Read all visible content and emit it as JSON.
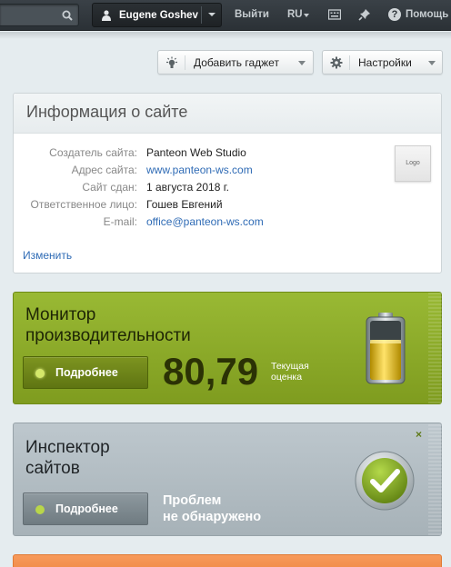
{
  "topbar": {
    "user_name": "Eugene Goshev",
    "logout_label": "Выйти",
    "language": "RU",
    "help_label": "Помощь"
  },
  "toolbar": {
    "add_gadget_label": "Добавить гаджет",
    "settings_label": "Настройки"
  },
  "site_info": {
    "title": "Информация о сайте",
    "rows": [
      {
        "label": "Создатель сайта:",
        "value": "Panteon Web Studio"
      },
      {
        "label": "Адрес сайта:",
        "value": "www.panteon-ws.com"
      },
      {
        "label": "Сайт сдан:",
        "value": "1 августа 2018 г."
      },
      {
        "label": "Ответственное лицо:",
        "value": "Гошев Евгений"
      },
      {
        "label": "E-mail:",
        "value": "office@panteon-ws.com"
      }
    ],
    "logo_text": "Logo",
    "edit_label": "Изменить"
  },
  "performance": {
    "title_line1": "Монитор",
    "title_line2": "производительности",
    "more_label": "Подробнее",
    "score": "80,79",
    "caption_line1": "Текущая",
    "caption_line2": "оценка"
  },
  "inspector": {
    "title_line1": "Инспектор",
    "title_line2": "сайтов",
    "close_label": "×",
    "more_label": "Подробнее",
    "status_line1": "Проблем",
    "status_line2": "не обнаружено"
  },
  "colors": {
    "topbar": "#2f363b",
    "link": "#2f6bb5",
    "perf_green": "#8fb12c",
    "inspector_gray": "#b2bcc2",
    "next_card_orange": "#f4914f"
  }
}
